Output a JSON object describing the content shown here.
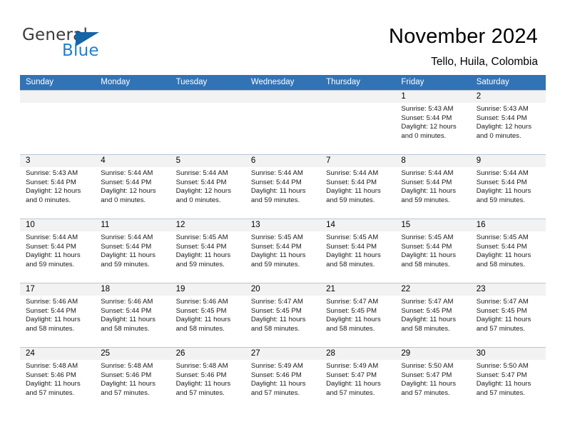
{
  "logo": {
    "word1": "General",
    "word2": "Blue",
    "triangle_color": "#1565a8",
    "blue_color": "#1f7fd0"
  },
  "header": {
    "title": "November 2024",
    "subtitle": "Tello, Huila, Colombia",
    "accent_color": "#3273b5"
  },
  "calendar": {
    "day_headers": [
      "Sunday",
      "Monday",
      "Tuesday",
      "Wednesday",
      "Thursday",
      "Friday",
      "Saturday"
    ],
    "weeks": [
      [
        {
          "day": "",
          "sunrise": "",
          "sunset": "",
          "daylight": ""
        },
        {
          "day": "",
          "sunrise": "",
          "sunset": "",
          "daylight": ""
        },
        {
          "day": "",
          "sunrise": "",
          "sunset": "",
          "daylight": ""
        },
        {
          "day": "",
          "sunrise": "",
          "sunset": "",
          "daylight": ""
        },
        {
          "day": "",
          "sunrise": "",
          "sunset": "",
          "daylight": ""
        },
        {
          "day": "1",
          "sunrise": "Sunrise: 5:43 AM",
          "sunset": "Sunset: 5:44 PM",
          "daylight": "Daylight: 12 hours and 0 minutes."
        },
        {
          "day": "2",
          "sunrise": "Sunrise: 5:43 AM",
          "sunset": "Sunset: 5:44 PM",
          "daylight": "Daylight: 12 hours and 0 minutes."
        }
      ],
      [
        {
          "day": "3",
          "sunrise": "Sunrise: 5:43 AM",
          "sunset": "Sunset: 5:44 PM",
          "daylight": "Daylight: 12 hours and 0 minutes."
        },
        {
          "day": "4",
          "sunrise": "Sunrise: 5:44 AM",
          "sunset": "Sunset: 5:44 PM",
          "daylight": "Daylight: 12 hours and 0 minutes."
        },
        {
          "day": "5",
          "sunrise": "Sunrise: 5:44 AM",
          "sunset": "Sunset: 5:44 PM",
          "daylight": "Daylight: 12 hours and 0 minutes."
        },
        {
          "day": "6",
          "sunrise": "Sunrise: 5:44 AM",
          "sunset": "Sunset: 5:44 PM",
          "daylight": "Daylight: 11 hours and 59 minutes."
        },
        {
          "day": "7",
          "sunrise": "Sunrise: 5:44 AM",
          "sunset": "Sunset: 5:44 PM",
          "daylight": "Daylight: 11 hours and 59 minutes."
        },
        {
          "day": "8",
          "sunrise": "Sunrise: 5:44 AM",
          "sunset": "Sunset: 5:44 PM",
          "daylight": "Daylight: 11 hours and 59 minutes."
        },
        {
          "day": "9",
          "sunrise": "Sunrise: 5:44 AM",
          "sunset": "Sunset: 5:44 PM",
          "daylight": "Daylight: 11 hours and 59 minutes."
        }
      ],
      [
        {
          "day": "10",
          "sunrise": "Sunrise: 5:44 AM",
          "sunset": "Sunset: 5:44 PM",
          "daylight": "Daylight: 11 hours and 59 minutes."
        },
        {
          "day": "11",
          "sunrise": "Sunrise: 5:44 AM",
          "sunset": "Sunset: 5:44 PM",
          "daylight": "Daylight: 11 hours and 59 minutes."
        },
        {
          "day": "12",
          "sunrise": "Sunrise: 5:45 AM",
          "sunset": "Sunset: 5:44 PM",
          "daylight": "Daylight: 11 hours and 59 minutes."
        },
        {
          "day": "13",
          "sunrise": "Sunrise: 5:45 AM",
          "sunset": "Sunset: 5:44 PM",
          "daylight": "Daylight: 11 hours and 59 minutes."
        },
        {
          "day": "14",
          "sunrise": "Sunrise: 5:45 AM",
          "sunset": "Sunset: 5:44 PM",
          "daylight": "Daylight: 11 hours and 58 minutes."
        },
        {
          "day": "15",
          "sunrise": "Sunrise: 5:45 AM",
          "sunset": "Sunset: 5:44 PM",
          "daylight": "Daylight: 11 hours and 58 minutes."
        },
        {
          "day": "16",
          "sunrise": "Sunrise: 5:45 AM",
          "sunset": "Sunset: 5:44 PM",
          "daylight": "Daylight: 11 hours and 58 minutes."
        }
      ],
      [
        {
          "day": "17",
          "sunrise": "Sunrise: 5:46 AM",
          "sunset": "Sunset: 5:44 PM",
          "daylight": "Daylight: 11 hours and 58 minutes."
        },
        {
          "day": "18",
          "sunrise": "Sunrise: 5:46 AM",
          "sunset": "Sunset: 5:44 PM",
          "daylight": "Daylight: 11 hours and 58 minutes."
        },
        {
          "day": "19",
          "sunrise": "Sunrise: 5:46 AM",
          "sunset": "Sunset: 5:45 PM",
          "daylight": "Daylight: 11 hours and 58 minutes."
        },
        {
          "day": "20",
          "sunrise": "Sunrise: 5:47 AM",
          "sunset": "Sunset: 5:45 PM",
          "daylight": "Daylight: 11 hours and 58 minutes."
        },
        {
          "day": "21",
          "sunrise": "Sunrise: 5:47 AM",
          "sunset": "Sunset: 5:45 PM",
          "daylight": "Daylight: 11 hours and 58 minutes."
        },
        {
          "day": "22",
          "sunrise": "Sunrise: 5:47 AM",
          "sunset": "Sunset: 5:45 PM",
          "daylight": "Daylight: 11 hours and 58 minutes."
        },
        {
          "day": "23",
          "sunrise": "Sunrise: 5:47 AM",
          "sunset": "Sunset: 5:45 PM",
          "daylight": "Daylight: 11 hours and 57 minutes."
        }
      ],
      [
        {
          "day": "24",
          "sunrise": "Sunrise: 5:48 AM",
          "sunset": "Sunset: 5:46 PM",
          "daylight": "Daylight: 11 hours and 57 minutes."
        },
        {
          "day": "25",
          "sunrise": "Sunrise: 5:48 AM",
          "sunset": "Sunset: 5:46 PM",
          "daylight": "Daylight: 11 hours and 57 minutes."
        },
        {
          "day": "26",
          "sunrise": "Sunrise: 5:48 AM",
          "sunset": "Sunset: 5:46 PM",
          "daylight": "Daylight: 11 hours and 57 minutes."
        },
        {
          "day": "27",
          "sunrise": "Sunrise: 5:49 AM",
          "sunset": "Sunset: 5:46 PM",
          "daylight": "Daylight: 11 hours and 57 minutes."
        },
        {
          "day": "28",
          "sunrise": "Sunrise: 5:49 AM",
          "sunset": "Sunset: 5:47 PM",
          "daylight": "Daylight: 11 hours and 57 minutes."
        },
        {
          "day": "29",
          "sunrise": "Sunrise: 5:50 AM",
          "sunset": "Sunset: 5:47 PM",
          "daylight": "Daylight: 11 hours and 57 minutes."
        },
        {
          "day": "30",
          "sunrise": "Sunrise: 5:50 AM",
          "sunset": "Sunset: 5:47 PM",
          "daylight": "Daylight: 11 hours and 57 minutes."
        }
      ]
    ]
  }
}
